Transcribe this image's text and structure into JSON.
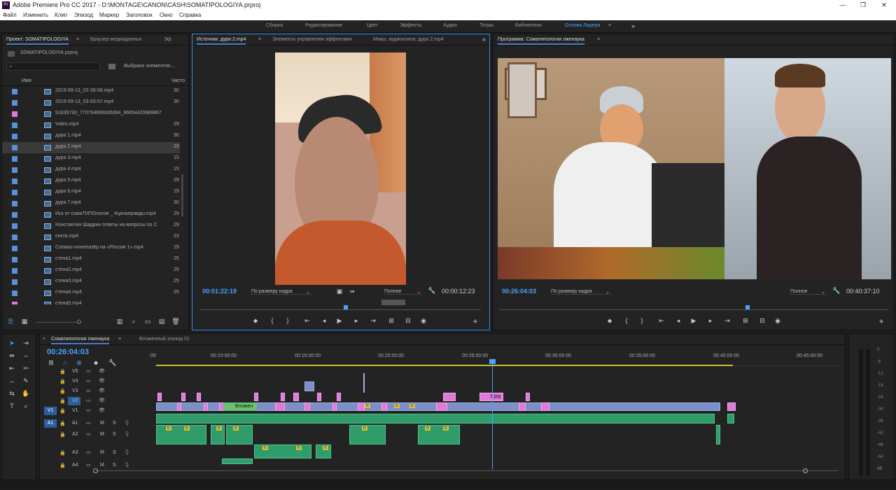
{
  "app": {
    "title": "Adobe Premiere Pro CC 2017 - D:\\MONTAGE\\CANON\\CASH\\SOMATIPOLOGIYA.prproj",
    "icon_text": "Pr"
  },
  "window_controls": [
    "—",
    "❐",
    "✕"
  ],
  "menu": [
    "Файл",
    "Изменить",
    "Клип",
    "Эпизод",
    "Маркер",
    "Заголовок",
    "Окно",
    "Справка"
  ],
  "workspaces": [
    "Сборка",
    "Редактирование",
    "Цвет",
    "Эффекты",
    "Аудио",
    "Титры",
    "Библиотеки",
    "Основа Лидера",
    "≡",
    "»"
  ],
  "project": {
    "tabs": [
      "Проект: SOMATIPOLOGIYA",
      "≡",
      "Браузер медиаданных",
      "Эф"
    ],
    "file": "SOMATIPOLOGIYA.prproj",
    "selected_text": "Выбрано элементов:...",
    "col_name": "Имя",
    "col_rate": "Часто",
    "items": [
      {
        "name": "2019-09-13_02-28-58.mp4",
        "rate": "30",
        "color": "#5b8fd6"
      },
      {
        "name": "2019-09-13_03-53-57.mp4",
        "rate": "30",
        "color": "#5b8fd6"
      },
      {
        "name": "51835730_770794696636084_86654429989867",
        "rate": "",
        "color": "#e07ad8"
      },
      {
        "name": "Video.mp4",
        "rate": "29",
        "color": "#5b8fd6"
      },
      {
        "name": "дура 1.mp4",
        "rate": "30",
        "color": "#5b8fd6"
      },
      {
        "name": "дура 2.mp4",
        "rate": "29",
        "color": "#5b8fd6"
      },
      {
        "name": "дура 3.mp4",
        "rate": "15",
        "color": "#5b8fd6"
      },
      {
        "name": "дура 4.mp4",
        "rate": "15",
        "color": "#5b8fd6"
      },
      {
        "name": "дура 5.mp4",
        "rate": "29",
        "color": "#5b8fd6"
      },
      {
        "name": "дура 6.mp4",
        "rate": "29",
        "color": "#5b8fd6"
      },
      {
        "name": "дура 7.mp4",
        "rate": "30",
        "color": "#5b8fd6"
      },
      {
        "name": "Иск от сомаТИПОлогов _ #ценаправды.mp4",
        "rate": "29",
        "color": "#5b8fd6"
      },
      {
        "name": "Константин Шадрин ответы на вопросы по С",
        "rate": "29",
        "color": "#5b8fd6"
      },
      {
        "name": "секта.mp4",
        "rate": "23",
        "color": "#5b8fd6"
      },
      {
        "name": "Собака-гипнотизёр на «Россия 1».mp4",
        "rate": "29",
        "color": "#5b8fd6"
      },
      {
        "name": "стена1.mp4",
        "rate": "25",
        "color": "#5b8fd6"
      },
      {
        "name": "стена2.mp4",
        "rate": "25",
        "color": "#5b8fd6"
      },
      {
        "name": "стена3.mp4",
        "rate": "25",
        "color": "#5b8fd6"
      },
      {
        "name": "стена4.mp4",
        "rate": "25",
        "color": "#5b8fd6"
      },
      {
        "name": "стена5.mp4",
        "rate": "",
        "color": "#e07ad8"
      }
    ]
  },
  "source": {
    "tabs": [
      "Источник: дура 2.mp4",
      "≡",
      "Элементы управления эффектами",
      "Микш. аудиоклипа: дура 2.mp4",
      "»"
    ],
    "timecode": "00:01:22:19",
    "fit": "По размеру кадра",
    "quality": "Полное",
    "duration": "00:00:12:23"
  },
  "program": {
    "tabs": [
      "Программа: Соматипология лженаука",
      "≡"
    ],
    "timecode": "00:26:04:03",
    "fit": "По размеру кадра",
    "quality": "Полное",
    "duration": "00:40:37:10"
  },
  "transport": [
    "⬥",
    "{",
    "}",
    "⇤",
    "◂",
    "▶",
    "▸",
    "⇥",
    "⊞",
    "⊟",
    "◉"
  ],
  "timeline": {
    "tabs": [
      "×",
      "Соматипология лженаука",
      "≡",
      "Вложенный эпизод 01"
    ],
    "timecode": "00:26:04:03",
    "ruler": [
      ":00",
      "00:10:00:00",
      "00:15:00:00",
      "00:20:00:00",
      "00:25:00:00",
      "00:30:00:00",
      "00:35:00:00",
      "00:40:00:00",
      "00:45:00:00"
    ],
    "video_tracks": [
      "V5",
      "V4",
      "V3",
      "V2",
      "V1"
    ],
    "audio_tracks": [
      "A1",
      "A2",
      "A3",
      "A4"
    ],
    "src_v": "V1",
    "src_a": "A1",
    "clip_labels": [
      "Вложен",
      "3.jpg"
    ],
    "m": "M",
    "s": "S"
  },
  "meter": {
    "scale": [
      "0",
      "-6",
      "-12",
      "-18",
      "-24",
      "-30",
      "-36",
      "-42",
      "-48",
      "-54",
      "dB"
    ]
  },
  "colors": {
    "accent": "#2d8ceb",
    "timecode": "#4aa3ff",
    "video_clip": "#7c8fc9",
    "audio_clip": "#2f9c6a",
    "pink_clip": "#e07ad8"
  }
}
